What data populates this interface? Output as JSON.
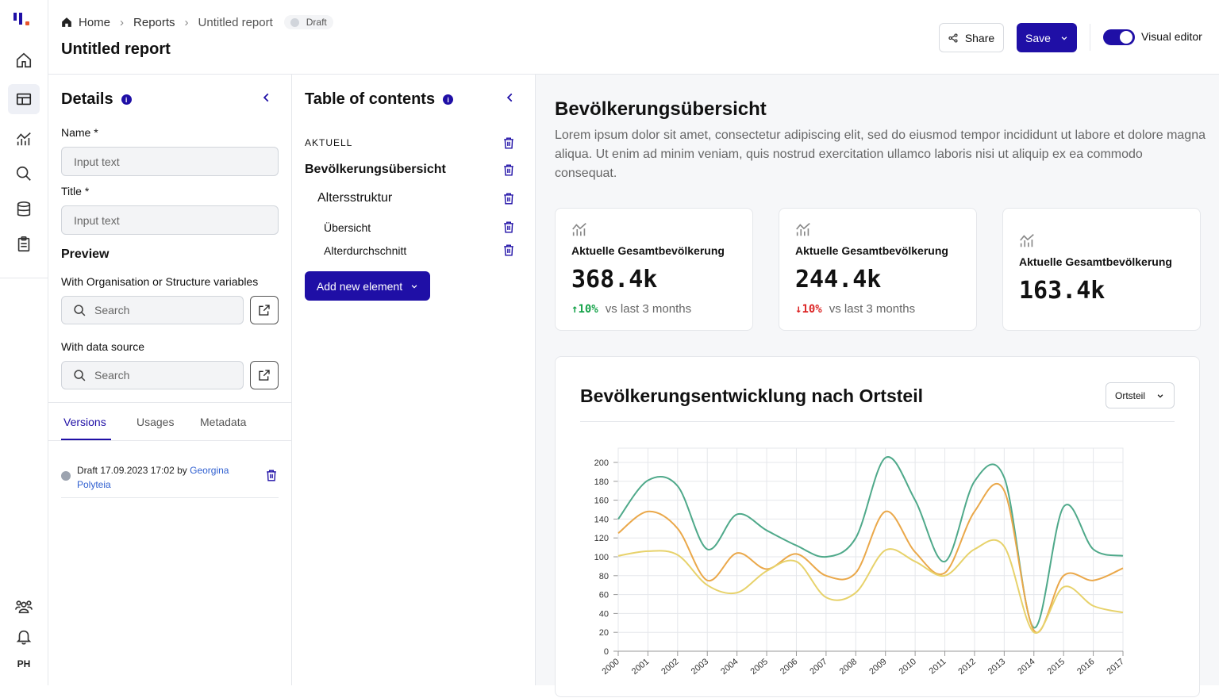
{
  "header": {
    "breadcrumbs": [
      "Home",
      "Reports",
      "Untitled report"
    ],
    "status_badge": "Draft",
    "page_title": "Untitled report",
    "share_label": "Share",
    "save_label": "Save",
    "toggle_label": "Visual editor",
    "toggle_on": true
  },
  "rail": {
    "icons": [
      "home-icon",
      "layout-icon",
      "analytics-icon",
      "search-icon",
      "database-icon",
      "clipboard-icon",
      "users-icon",
      "bell-icon"
    ],
    "user_initials": "PH"
  },
  "details": {
    "title": "Details",
    "name_label": "Name *",
    "name_placeholder": "Input text",
    "title_label": "Title *",
    "title_placeholder": "Input text",
    "preview_title": "Preview",
    "org_label": "With Organisation or Structure variables",
    "org_search_placeholder": "Search",
    "source_label": "With data source",
    "source_search_placeholder": "Search",
    "tabs": [
      "Versions",
      "Usages",
      "Metadata"
    ],
    "version": {
      "text": "Draft 17.09.2023 17:02 by ",
      "author": "Georgina Polyteia"
    }
  },
  "toc": {
    "title": "Table of contents",
    "section_label": "AKTUELL",
    "items": [
      "Bevölkerungsübersicht",
      "Altersstruktur",
      "Übersicht",
      "Alterdurchschnitt"
    ],
    "add_label": "Add new element"
  },
  "content": {
    "title": "Bevölkerungsübersicht",
    "description": "Lorem ipsum dolor sit amet, consectetur adipiscing elit, sed do eiusmod tempor incididunt ut labore et dolore magna aliqua. Ut enim ad minim veniam, quis nostrud exercitation ullamco laboris nisi ut aliquip ex ea commodo consequat.",
    "cards": [
      {
        "label": "Aktuelle Gesamtbevölkerung",
        "value": "368.4k",
        "change": "10%",
        "direction": "up",
        "compare": "vs last 3 months"
      },
      {
        "label": "Aktuelle Gesamtbevölkerung",
        "value": "244.4k",
        "change": "10%",
        "direction": "down",
        "compare": "vs last 3 months"
      },
      {
        "label": "Aktuelle Gesamtbevölkerung",
        "value": "163.4k"
      }
    ],
    "chart_title": "Bevölkerungsentwicklung nach Ortsteil",
    "dropdown_value": "Ortsteil"
  },
  "colors": {
    "accent": "#1f0fa6",
    "up": "#16a34a",
    "down": "#dc2626"
  },
  "chart_data": {
    "type": "line",
    "title": "Bevölkerungsentwicklung nach Ortsteil",
    "x": [
      "2000",
      "2001",
      "2002",
      "2003",
      "2004",
      "2005",
      "2006",
      "2007",
      "2008",
      "2009",
      "2010",
      "2011",
      "2012",
      "2013",
      "2014",
      "2015",
      "2016",
      "2017"
    ],
    "ylim": [
      0,
      200
    ],
    "yticks": [
      0,
      20,
      40,
      60,
      80,
      100,
      120,
      140,
      160,
      180,
      200
    ],
    "grid": true,
    "series": [
      {
        "color": "#4fa98a",
        "values": [
          140,
          181,
          175,
          108,
          145,
          128,
          112,
          100,
          120,
          205,
          160,
          95,
          180,
          184,
          25,
          153,
          108,
          101
        ]
      },
      {
        "color": "#eaa84a",
        "values": [
          125,
          148,
          130,
          75,
          104,
          87,
          103,
          80,
          83,
          148,
          105,
          83,
          148,
          170,
          22,
          80,
          75,
          88
        ]
      },
      {
        "color": "#e7d26b",
        "values": [
          101,
          106,
          102,
          70,
          62,
          85,
          95,
          57,
          62,
          107,
          95,
          80,
          108,
          111,
          20,
          68,
          48,
          41
        ]
      }
    ]
  }
}
